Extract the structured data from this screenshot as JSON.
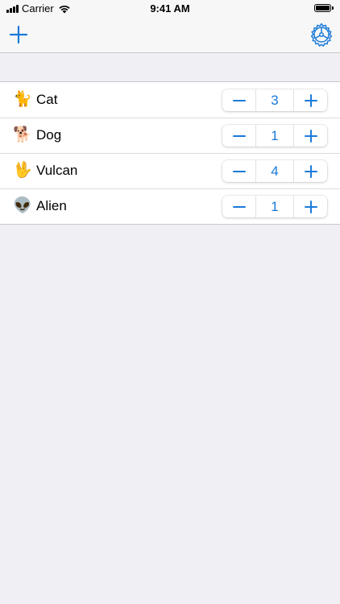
{
  "status_bar": {
    "carrier": "Carrier",
    "time": "9:41 AM"
  },
  "nav": {
    "add_icon": "plus-icon",
    "settings_icon": "gear-icon"
  },
  "accent_color": "#1a7ad9",
  "items": [
    {
      "emoji": "🐈",
      "label": "Cat",
      "count": "3"
    },
    {
      "emoji": "🐕",
      "label": "Dog",
      "count": "1"
    },
    {
      "emoji": "🖖",
      "label": "Vulcan",
      "count": "4"
    },
    {
      "emoji": "👽",
      "label": "Alien",
      "count": "1"
    }
  ]
}
